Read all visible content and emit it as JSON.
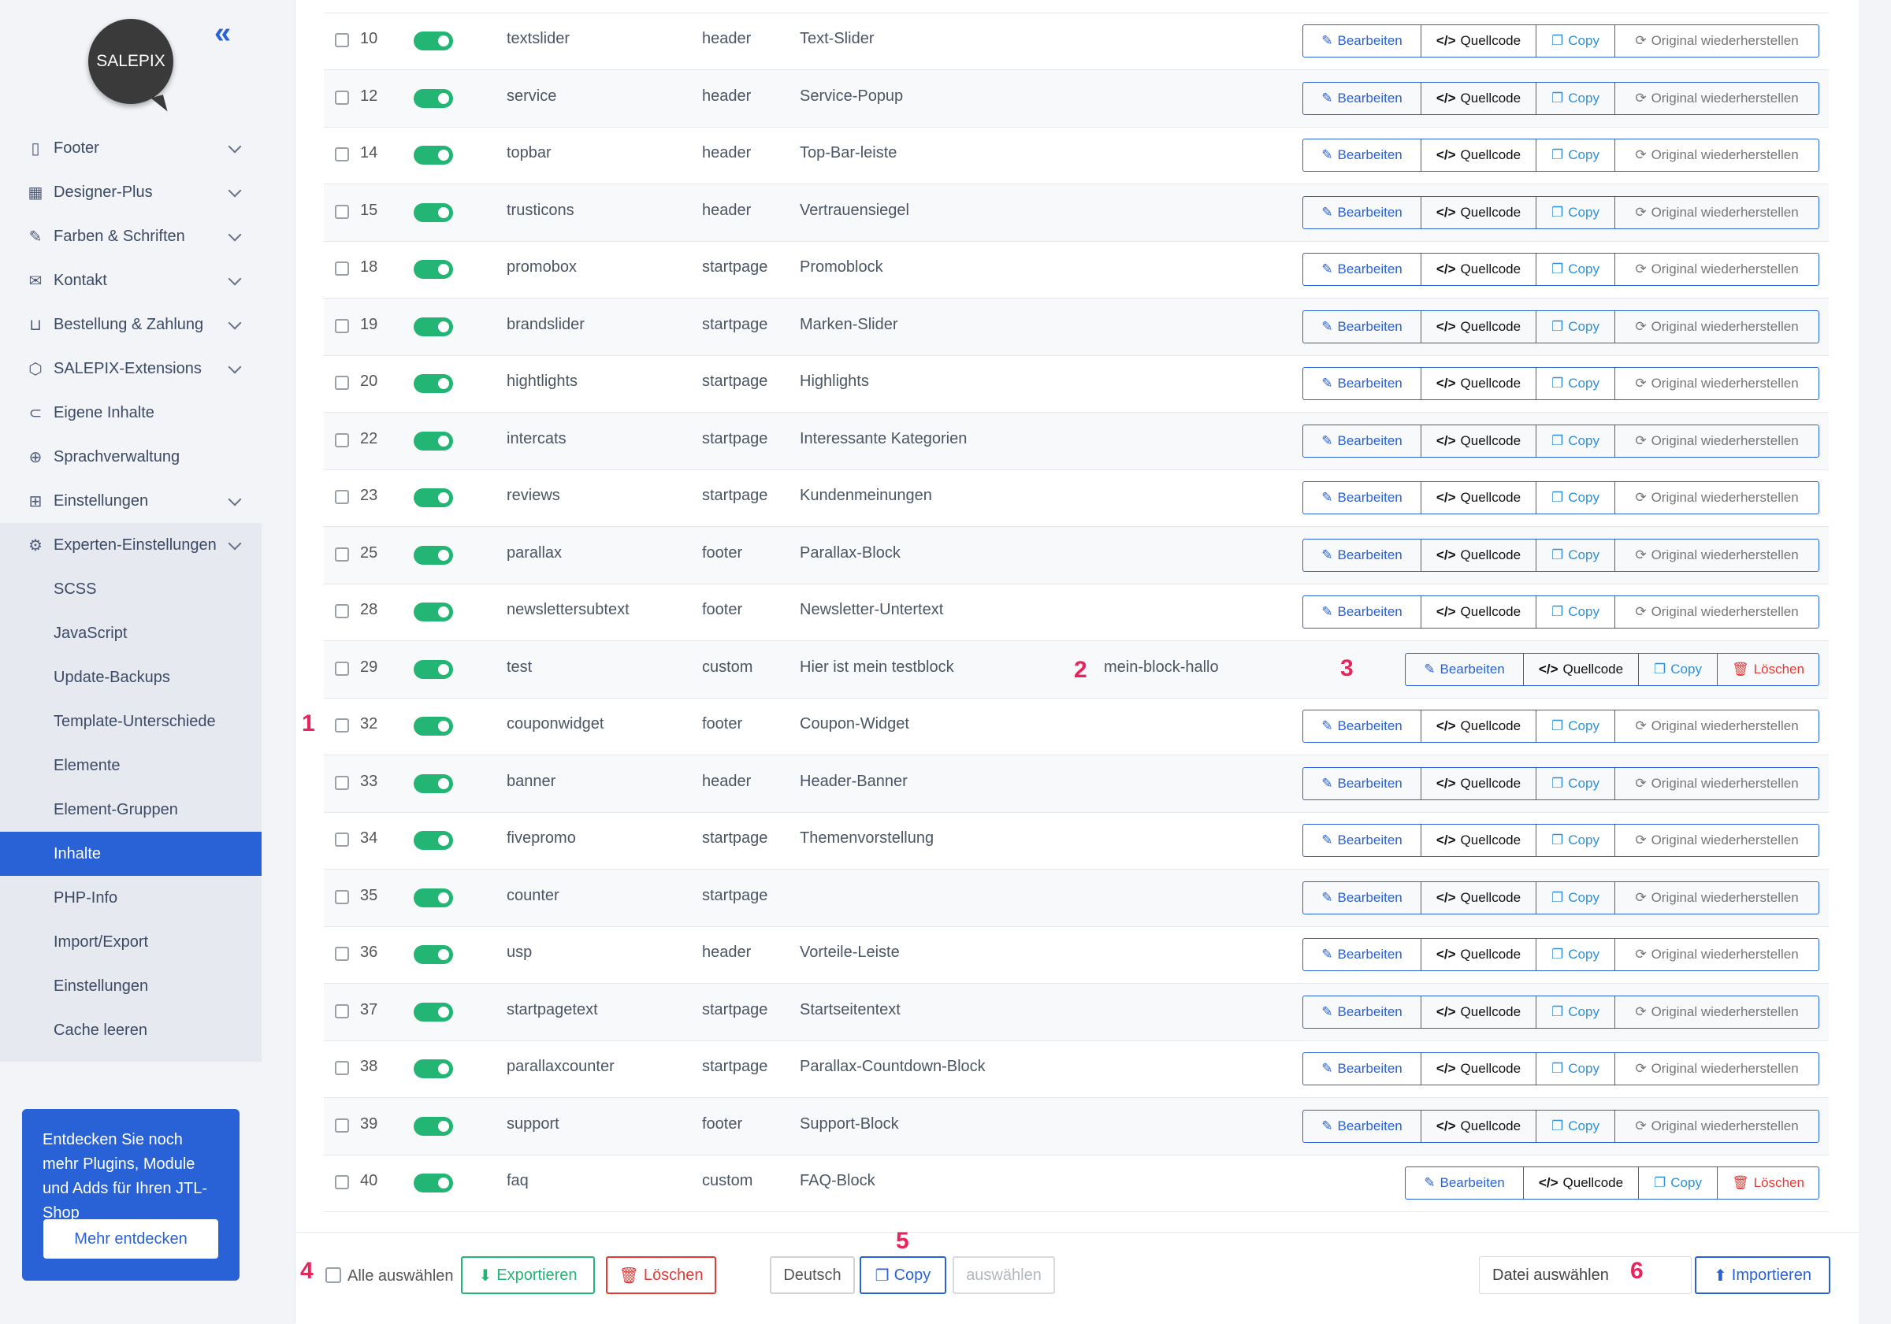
{
  "sidebar": {
    "logo": "SALEPIX",
    "collapse_icon": "«",
    "items": [
      {
        "label": "Footer",
        "icon": "page-icon",
        "glyph": "▯",
        "chevron": true
      },
      {
        "label": "Designer-Plus",
        "icon": "grid-icon",
        "glyph": "▦",
        "chevron": true
      },
      {
        "label": "Farben & Schriften",
        "icon": "brush-icon",
        "glyph": "✎",
        "chevron": true
      },
      {
        "label": "Kontakt",
        "icon": "mail-icon",
        "glyph": "✉",
        "chevron": true
      },
      {
        "label": "Bestellung & Zahlung",
        "icon": "basket-icon",
        "glyph": "⊔",
        "chevron": true
      },
      {
        "label": "SALEPIX-Extensions",
        "icon": "cube-icon",
        "glyph": "⬡",
        "chevron": true
      },
      {
        "label": "Eigene Inhalte",
        "icon": "toggle-icon",
        "glyph": "⊂",
        "chevron": false
      },
      {
        "label": "Sprachverwaltung",
        "icon": "globe-icon",
        "glyph": "⊕",
        "chevron": false
      },
      {
        "label": "Einstellungen",
        "icon": "table-icon",
        "glyph": "⊞",
        "chevron": true
      },
      {
        "label": "Experten-Einstellungen",
        "icon": "gear-icon",
        "glyph": "⚙",
        "chevron": true
      }
    ],
    "subitems": [
      "SCSS",
      "JavaScript",
      "Update-Backups",
      "Template-Unterschiede",
      "Elemente",
      "Element-Gruppen",
      "Inhalte",
      "PHP-Info",
      "Import/Export",
      "Einstellungen",
      "Cache leeren"
    ],
    "active_subitem": "Inhalte",
    "promo": {
      "text": "Entdecken Sie noch mehr Plugins, Module und Adds für Ihren JTL-Shop",
      "button": "Mehr entdecken"
    }
  },
  "buttons": {
    "edit": "Bearbeiten",
    "source": "Quellcode",
    "copy": "Copy",
    "restore": "Original wiederherstellen",
    "delete": "Löschen"
  },
  "rows": [
    {
      "id": "10",
      "name": "textslider",
      "position": "header",
      "title": "Text-Slider",
      "extra": "",
      "custom": false
    },
    {
      "id": "12",
      "name": "service",
      "position": "header",
      "title": "Service-Popup",
      "extra": "",
      "custom": false
    },
    {
      "id": "14",
      "name": "topbar",
      "position": "header",
      "title": "Top-Bar-leiste",
      "extra": "",
      "custom": false
    },
    {
      "id": "15",
      "name": "trusticons",
      "position": "header",
      "title": "Vertrauensiegel",
      "extra": "",
      "custom": false
    },
    {
      "id": "18",
      "name": "promobox",
      "position": "startpage",
      "title": "Promoblock",
      "extra": "",
      "custom": false
    },
    {
      "id": "19",
      "name": "brandslider",
      "position": "startpage",
      "title": "Marken-Slider",
      "extra": "",
      "custom": false
    },
    {
      "id": "20",
      "name": "hightlights",
      "position": "startpage",
      "title": "Highlights",
      "extra": "",
      "custom": false
    },
    {
      "id": "22",
      "name": "intercats",
      "position": "startpage",
      "title": "Interessante Kategorien",
      "extra": "",
      "custom": false
    },
    {
      "id": "23",
      "name": "reviews",
      "position": "startpage",
      "title": "Kundenmeinungen",
      "extra": "",
      "custom": false
    },
    {
      "id": "25",
      "name": "parallax",
      "position": "footer",
      "title": "Parallax-Block",
      "extra": "",
      "custom": false
    },
    {
      "id": "28",
      "name": "newslettersubtext",
      "position": "footer",
      "title": "Newsletter-Untertext",
      "extra": "",
      "custom": false
    },
    {
      "id": "29",
      "name": "test",
      "position": "custom",
      "title": "Hier ist mein testblock",
      "extra": "mein-block-hallo",
      "custom": true
    },
    {
      "id": "32",
      "name": "couponwidget",
      "position": "footer",
      "title": "Coupon-Widget",
      "extra": "",
      "custom": false
    },
    {
      "id": "33",
      "name": "banner",
      "position": "header",
      "title": "Header-Banner",
      "extra": "",
      "custom": false
    },
    {
      "id": "34",
      "name": "fivepromo",
      "position": "startpage",
      "title": "Themenvorstellung",
      "extra": "",
      "custom": false
    },
    {
      "id": "35",
      "name": "counter",
      "position": "startpage",
      "title": "",
      "extra": "",
      "custom": false
    },
    {
      "id": "36",
      "name": "usp",
      "position": "header",
      "title": "Vorteile-Leiste",
      "extra": "",
      "custom": false
    },
    {
      "id": "37",
      "name": "startpagetext",
      "position": "startpage",
      "title": "Startseitentext",
      "extra": "",
      "custom": false
    },
    {
      "id": "38",
      "name": "parallaxcounter",
      "position": "startpage",
      "title": "Parallax-Countdown-Block",
      "extra": "",
      "custom": false
    },
    {
      "id": "39",
      "name": "support",
      "position": "footer",
      "title": "Support-Block",
      "extra": "",
      "custom": false
    },
    {
      "id": "40",
      "name": "faq",
      "position": "custom",
      "title": "FAQ-Block",
      "extra": "",
      "custom": true
    }
  ],
  "footer": {
    "select_all": "Alle auswählen",
    "export": "Exportieren",
    "delete": "Löschen",
    "language": "Deutsch",
    "copy": "Copy",
    "choose": "auswählen",
    "file": "Datei auswählen",
    "import": "Importieren"
  },
  "markers": [
    "1",
    "2",
    "3",
    "4",
    "5",
    "6"
  ],
  "colors": {
    "primary": "#2962d6",
    "success": "#22b573",
    "danger": "#e53935",
    "marker": "#e8245c"
  }
}
